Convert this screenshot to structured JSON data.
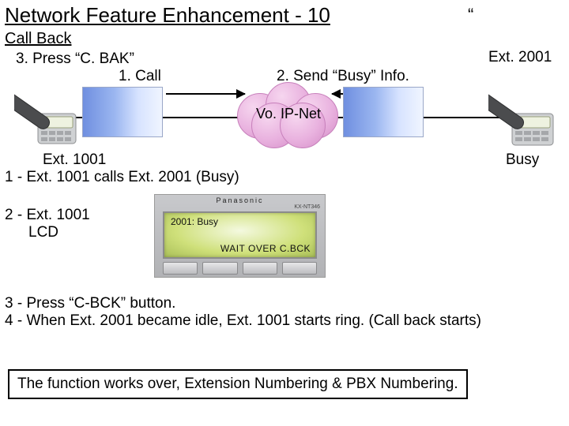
{
  "title": "Network Feature Enhancement - 10",
  "quote_mark": "“",
  "subtitle": "Call Back",
  "annotations": {
    "step3": "3. Press “C. BAK”",
    "step1_call": "1. Call",
    "step2_busy": "2. Send “Busy” Info.",
    "ext_a": "Ext. 2001",
    "ext_b": "Ext. 1001",
    "busy": "Busy",
    "cloud": "Vo. IP-Net"
  },
  "steps": {
    "line1": "1 - Ext. 1001 calls Ext. 2001 (Busy)",
    "line2a": "2 - Ext. 1001",
    "line2b": "LCD",
    "line3": "3 - Press “C-BCK” button.",
    "line4": "4 - When Ext. 2001 became idle, Ext. 1001 starts ring. (Call back starts)"
  },
  "lcd": {
    "brand": "Panasonic",
    "model": "KX-NT346",
    "line1": "2001: Busy",
    "line2": "WAIT  OVER  C.BCK"
  },
  "notice": "The function works over, Extension Numbering & PBX Numbering."
}
